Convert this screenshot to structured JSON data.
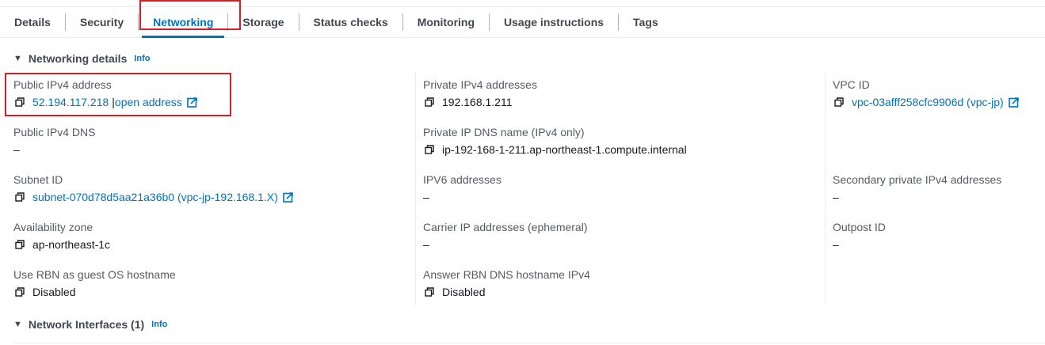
{
  "tabs": [
    {
      "label": "Details"
    },
    {
      "label": "Security"
    },
    {
      "label": "Networking",
      "active": true
    },
    {
      "label": "Storage"
    },
    {
      "label": "Status checks"
    },
    {
      "label": "Monitoring"
    },
    {
      "label": "Usage instructions"
    },
    {
      "label": "Tags"
    }
  ],
  "networking_details": {
    "title": "Networking details",
    "info": "Info"
  },
  "fields": {
    "public_ipv4": {
      "label": "Public IPv4 address",
      "value": "52.194.117.218",
      "separator": "|",
      "open_link": "open address"
    },
    "private_ipv4": {
      "label": "Private IPv4 addresses",
      "value": "192.168.1.211"
    },
    "vpc_id": {
      "label": "VPC ID",
      "value": "vpc-03afff258cfc9906d (vpc-jp)"
    },
    "public_dns": {
      "label": "Public IPv4 DNS",
      "value": "–"
    },
    "private_dns_name": {
      "label": "Private IP DNS name (IPv4 only)",
      "value": "ip-192-168-1-211.ap-northeast-1.compute.internal"
    },
    "subnet_id": {
      "label": "Subnet ID",
      "value": "subnet-070d78d5aa21a36b0 (vpc-jp-192.168.1.X)"
    },
    "ipv6": {
      "label": "IPV6 addresses",
      "value": "–"
    },
    "secondary_private_ipv4": {
      "label": "Secondary private IPv4 addresses",
      "value": "–"
    },
    "availability_zone": {
      "label": "Availability zone",
      "value": "ap-northeast-1c"
    },
    "carrier_ip": {
      "label": "Carrier IP addresses (ephemeral)",
      "value": "–"
    },
    "outpost_id": {
      "label": "Outpost ID",
      "value": "–"
    },
    "use_rbn": {
      "label": "Use RBN as guest OS hostname",
      "value": "Disabled"
    },
    "answer_rbn": {
      "label": "Answer RBN DNS hostname IPv4",
      "value": "Disabled"
    }
  },
  "network_interfaces": {
    "title": "Network Interfaces (1)",
    "info": "Info"
  },
  "colors": {
    "link": "#0073bb",
    "highlight": "#d91c26",
    "label": "#545b64"
  }
}
